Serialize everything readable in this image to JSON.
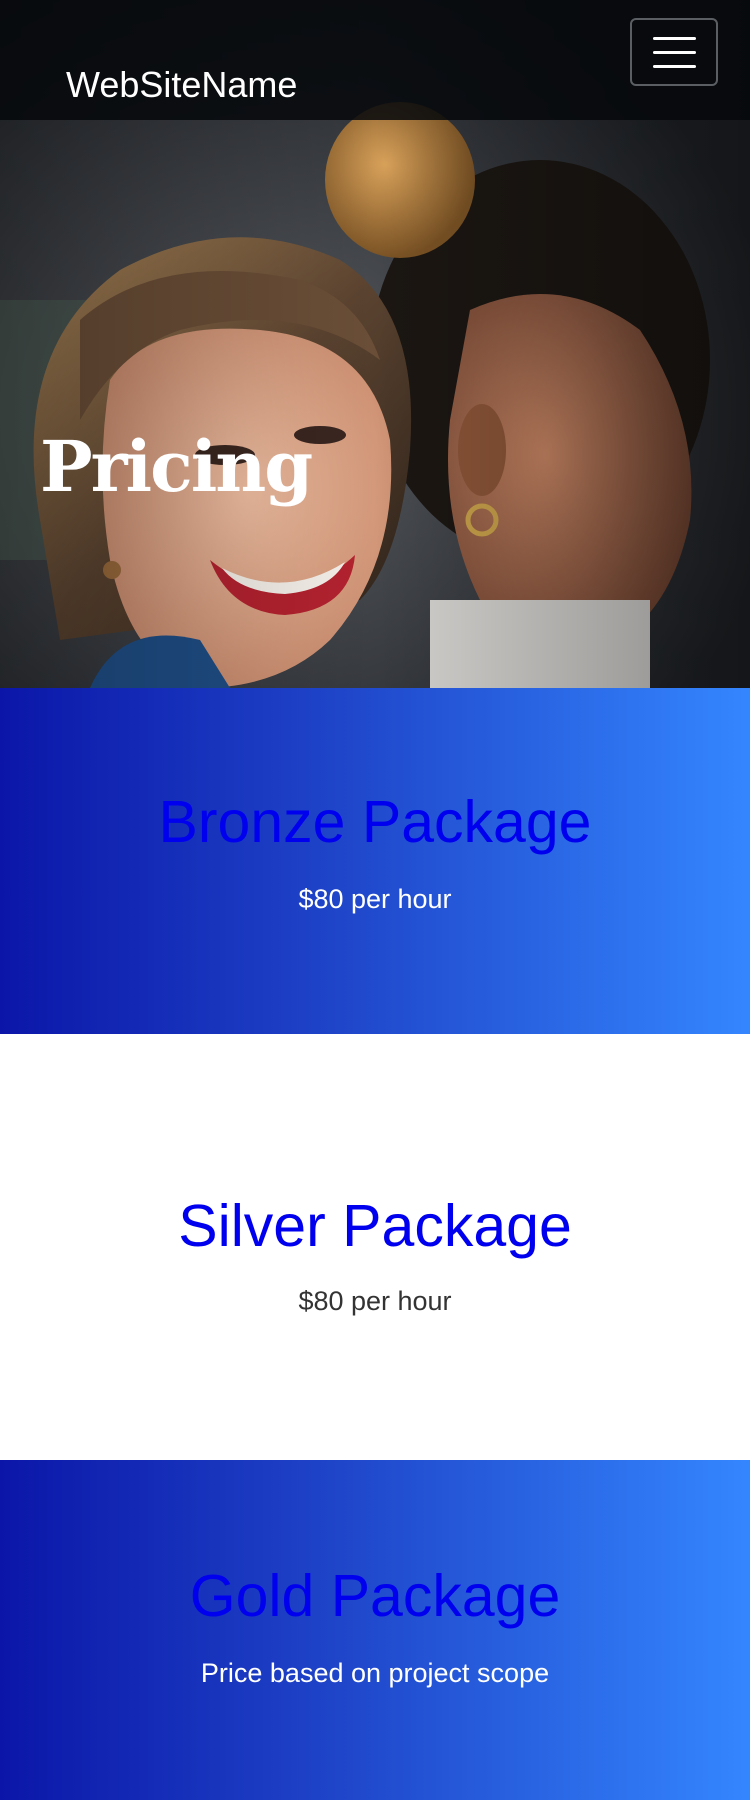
{
  "header": {
    "brand": "WebSiteName",
    "menu_icon": "hamburger-menu-icon"
  },
  "hero": {
    "title": "Pricing",
    "image": "photo of two smiling women"
  },
  "packages": [
    {
      "name": "Bronze Package",
      "price": "$80 per hour"
    },
    {
      "name": "Silver Package",
      "price": "$80 per hour"
    },
    {
      "name": "Gold Package",
      "price": "Price based on project scope"
    }
  ],
  "colors": {
    "navbar_bg": "#06080c",
    "package_title": "#0000ee",
    "gradient_start": "#0b16a8",
    "gradient_end": "#3486ff",
    "plain_bg": "#ffffff"
  }
}
